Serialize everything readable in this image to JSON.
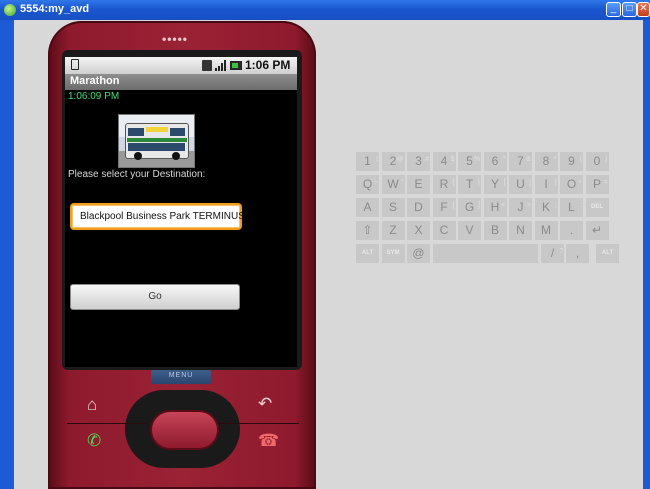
{
  "window": {
    "title": "5554:my_avd",
    "buttons": [
      "minimize",
      "maximize",
      "close"
    ]
  },
  "phone": {
    "status_time": "1:06 PM",
    "app_title": "Marathon",
    "clock_text": "1:06:09 PM",
    "prompt": "Please select your Destination:",
    "destination_value": "Blackpool Business Park TERMINUS",
    "go_label": "Go",
    "menu_label": "MENU",
    "speaker": "•••••"
  },
  "keyboard": {
    "row1": [
      [
        "1",
        "!"
      ],
      [
        "2",
        "@"
      ],
      [
        "3",
        "#"
      ],
      [
        "4",
        "$"
      ],
      [
        "5",
        "%"
      ],
      [
        "6",
        "^"
      ],
      [
        "7",
        "&"
      ],
      [
        "8",
        "*"
      ],
      [
        "9",
        "("
      ],
      [
        "0",
        ")"
      ]
    ],
    "row2": [
      [
        "Q",
        "~"
      ],
      [
        "W",
        "\""
      ],
      [
        "E",
        "`"
      ],
      [
        "R",
        "{"
      ],
      [
        "T",
        "}"
      ],
      [
        "Y",
        "["
      ],
      [
        "U",
        "]"
      ],
      [
        "I",
        "|"
      ],
      [
        "O",
        "+"
      ],
      [
        "P",
        "="
      ]
    ],
    "row3": [
      [
        "A",
        ""
      ],
      [
        "S",
        ""
      ],
      [
        "D",
        ""
      ],
      [
        "F",
        "["
      ],
      [
        "G",
        "]"
      ],
      [
        "H",
        "<"
      ],
      [
        "J",
        ">"
      ],
      [
        "K",
        ";"
      ],
      [
        "L",
        ":"
      ],
      [
        "DEL",
        ""
      ]
    ],
    "row4": [
      [
        "⇧",
        ""
      ],
      [
        "Z",
        ""
      ],
      [
        "X",
        ""
      ],
      [
        "C",
        ""
      ],
      [
        "V",
        ""
      ],
      [
        "B",
        ""
      ],
      [
        "N",
        ""
      ],
      [
        "M",
        ""
      ],
      [
        ".",
        ""
      ],
      [
        "↵",
        ""
      ]
    ],
    "row5": [
      [
        "ALT",
        ""
      ],
      [
        "SYM",
        ""
      ],
      [
        "@",
        ""
      ],
      [
        "␣",
        ""
      ],
      [
        "/",
        "?"
      ],
      [
        ",",
        ""
      ],
      [
        "ALT",
        ""
      ]
    ]
  },
  "colors": {
    "titlebar": "#1a56cf",
    "phone_body": "#8e1a2d",
    "spinner_border": "#f29d1c",
    "clock_text": "#3fe07a"
  }
}
